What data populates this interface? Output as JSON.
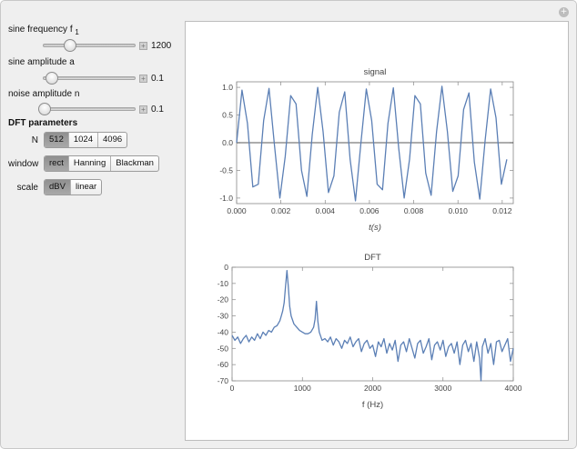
{
  "controls": {
    "sine_frequency": {
      "label": "sine frequency f",
      "subscript": "1",
      "value": "1200",
      "fraction": 0.29
    },
    "sine_amplitude": {
      "label": "sine amplitude a",
      "value": "0.1",
      "fraction": 0.1
    },
    "noise_amplitude": {
      "label": "noise amplitude n",
      "value": "0.1",
      "fraction": 0.02
    }
  },
  "dft_parameters": {
    "title": "DFT parameters",
    "N": {
      "label": "N",
      "options": [
        "512",
        "1024",
        "4096"
      ],
      "selected": "512"
    },
    "window": {
      "label": "window",
      "options": [
        "rect",
        "Hanning",
        "Blackman"
      ],
      "selected": "rect"
    },
    "scale": {
      "label": "scale",
      "options": [
        "dBV",
        "linear"
      ],
      "selected": "dBV"
    }
  },
  "icons": {
    "options": "plus-circle-icon",
    "increment": "plus-icon"
  },
  "colors": {
    "line": "#5b7fb5",
    "active_segment": "#9c9c9c"
  },
  "chart_data": [
    {
      "type": "line",
      "title": "signal",
      "xlabel": "t(s)",
      "ylabel": "",
      "xlim": [
        0,
        0.0125
      ],
      "ylim": [
        -1.1,
        1.1
      ],
      "x_ticks": [
        "0.000",
        "0.002",
        "0.004",
        "0.006",
        "0.008",
        "0.010",
        "0.012"
      ],
      "y_ticks": [
        "1.0",
        "0.5",
        "0.0",
        "-0.5",
        "-1.0"
      ],
      "series": [
        {
          "t": [
            0,
            0.000244,
            0.000488,
            0.000732,
            0.000977,
            0.001221,
            0.001465,
            0.001709,
            0.001953,
            0.002197,
            0.002441,
            0.002686,
            0.00293,
            0.003174,
            0.003418,
            0.003662,
            0.003906,
            0.00415,
            0.004395,
            0.004639,
            0.004883,
            0.005127,
            0.005371,
            0.005615,
            0.005859,
            0.006104,
            0.006348,
            0.006592,
            0.006836,
            0.00708,
            0.007324,
            0.007568,
            0.007813,
            0.008057,
            0.008301,
            0.008545,
            0.008789,
            0.009033,
            0.009277,
            0.009521,
            0.009766,
            0.01001,
            0.010254,
            0.010498,
            0.010742,
            0.010986,
            0.01123,
            0.011475,
            0.011719,
            0.011963,
            0.012207
          ],
          "v": [
            0.0,
            0.95,
            0.35,
            -0.8,
            -0.75,
            0.4,
            0.98,
            -0.05,
            -1.0,
            -0.25,
            0.85,
            0.7,
            -0.5,
            -0.97,
            0.15,
            1.0,
            0.2,
            -0.9,
            -0.6,
            0.55,
            0.92,
            -0.3,
            -1.05,
            0.0,
            0.97,
            0.4,
            -0.75,
            -0.85,
            0.35,
            0.99,
            -0.1,
            -1.0,
            -0.3,
            0.85,
            0.7,
            -0.55,
            -0.95,
            0.2,
            1.02,
            0.2,
            -0.88,
            -0.6,
            0.6,
            0.9,
            -0.35,
            -1.02,
            0.05,
            0.97,
            0.45,
            -0.75,
            -0.3
          ]
        }
      ]
    },
    {
      "type": "line",
      "title": "DFT",
      "xlabel": "f (Hz)",
      "ylabel": "",
      "xlim": [
        0,
        4000
      ],
      "ylim": [
        -70,
        0
      ],
      "x_ticks": [
        "0",
        "1000",
        "2000",
        "3000",
        "4000"
      ],
      "y_ticks": [
        "0",
        "-10",
        "-20",
        "-30",
        "-40",
        "-50",
        "-60",
        "-70"
      ],
      "series": [
        {
          "f": [
            0,
            40,
            80,
            120,
            160,
            200,
            240,
            280,
            320,
            360,
            400,
            440,
            480,
            520,
            560,
            600,
            640,
            680,
            700,
            720,
            740,
            760,
            780,
            800,
            820,
            840,
            880,
            920,
            960,
            1000,
            1040,
            1080,
            1120,
            1160,
            1180,
            1200,
            1220,
            1240,
            1280,
            1320,
            1360,
            1400,
            1440,
            1480,
            1520,
            1560,
            1600,
            1640,
            1680,
            1720,
            1760,
            1800,
            1840,
            1880,
            1920,
            1960,
            2000,
            2040,
            2080,
            2120,
            2160,
            2200,
            2240,
            2280,
            2320,
            2360,
            2400,
            2440,
            2480,
            2520,
            2560,
            2600,
            2640,
            2680,
            2720,
            2760,
            2800,
            2840,
            2880,
            2920,
            2960,
            3000,
            3040,
            3080,
            3120,
            3160,
            3200,
            3240,
            3280,
            3320,
            3360,
            3400,
            3440,
            3480,
            3520,
            3540,
            3560,
            3600,
            3640,
            3680,
            3720,
            3760,
            3800,
            3840,
            3880,
            3920,
            3960,
            4000
          ],
          "db": [
            -42,
            -45,
            -43,
            -47,
            -44,
            -42,
            -46,
            -43,
            -45,
            -41,
            -44,
            -40,
            -42,
            -39,
            -40,
            -37,
            -36,
            -33,
            -30,
            -27,
            -22,
            -12,
            -2,
            -12,
            -24,
            -30,
            -35,
            -37,
            -39,
            -40,
            -41,
            -41,
            -40,
            -37,
            -32,
            -21,
            -33,
            -40,
            -45,
            -44,
            -46,
            -43,
            -48,
            -44,
            -46,
            -50,
            -45,
            -47,
            -43,
            -49,
            -46,
            -44,
            -52,
            -47,
            -45,
            -50,
            -48,
            -55,
            -46,
            -49,
            -44,
            -53,
            -47,
            -51,
            -45,
            -58,
            -48,
            -46,
            -52,
            -44,
            -50,
            -56,
            -47,
            -45,
            -53,
            -49,
            -44,
            -57,
            -48,
            -46,
            -51,
            -45,
            -55,
            -49,
            -47,
            -53,
            -46,
            -60,
            -48,
            -45,
            -52,
            -47,
            -58,
            -46,
            -56,
            -70,
            -49,
            -44,
            -53,
            -47,
            -60,
            -46,
            -45,
            -52,
            -48,
            -44,
            -58,
            -50,
            -46,
            -54,
            -48,
            -45,
            -56,
            -47,
            -44
          ]
        }
      ]
    }
  ]
}
